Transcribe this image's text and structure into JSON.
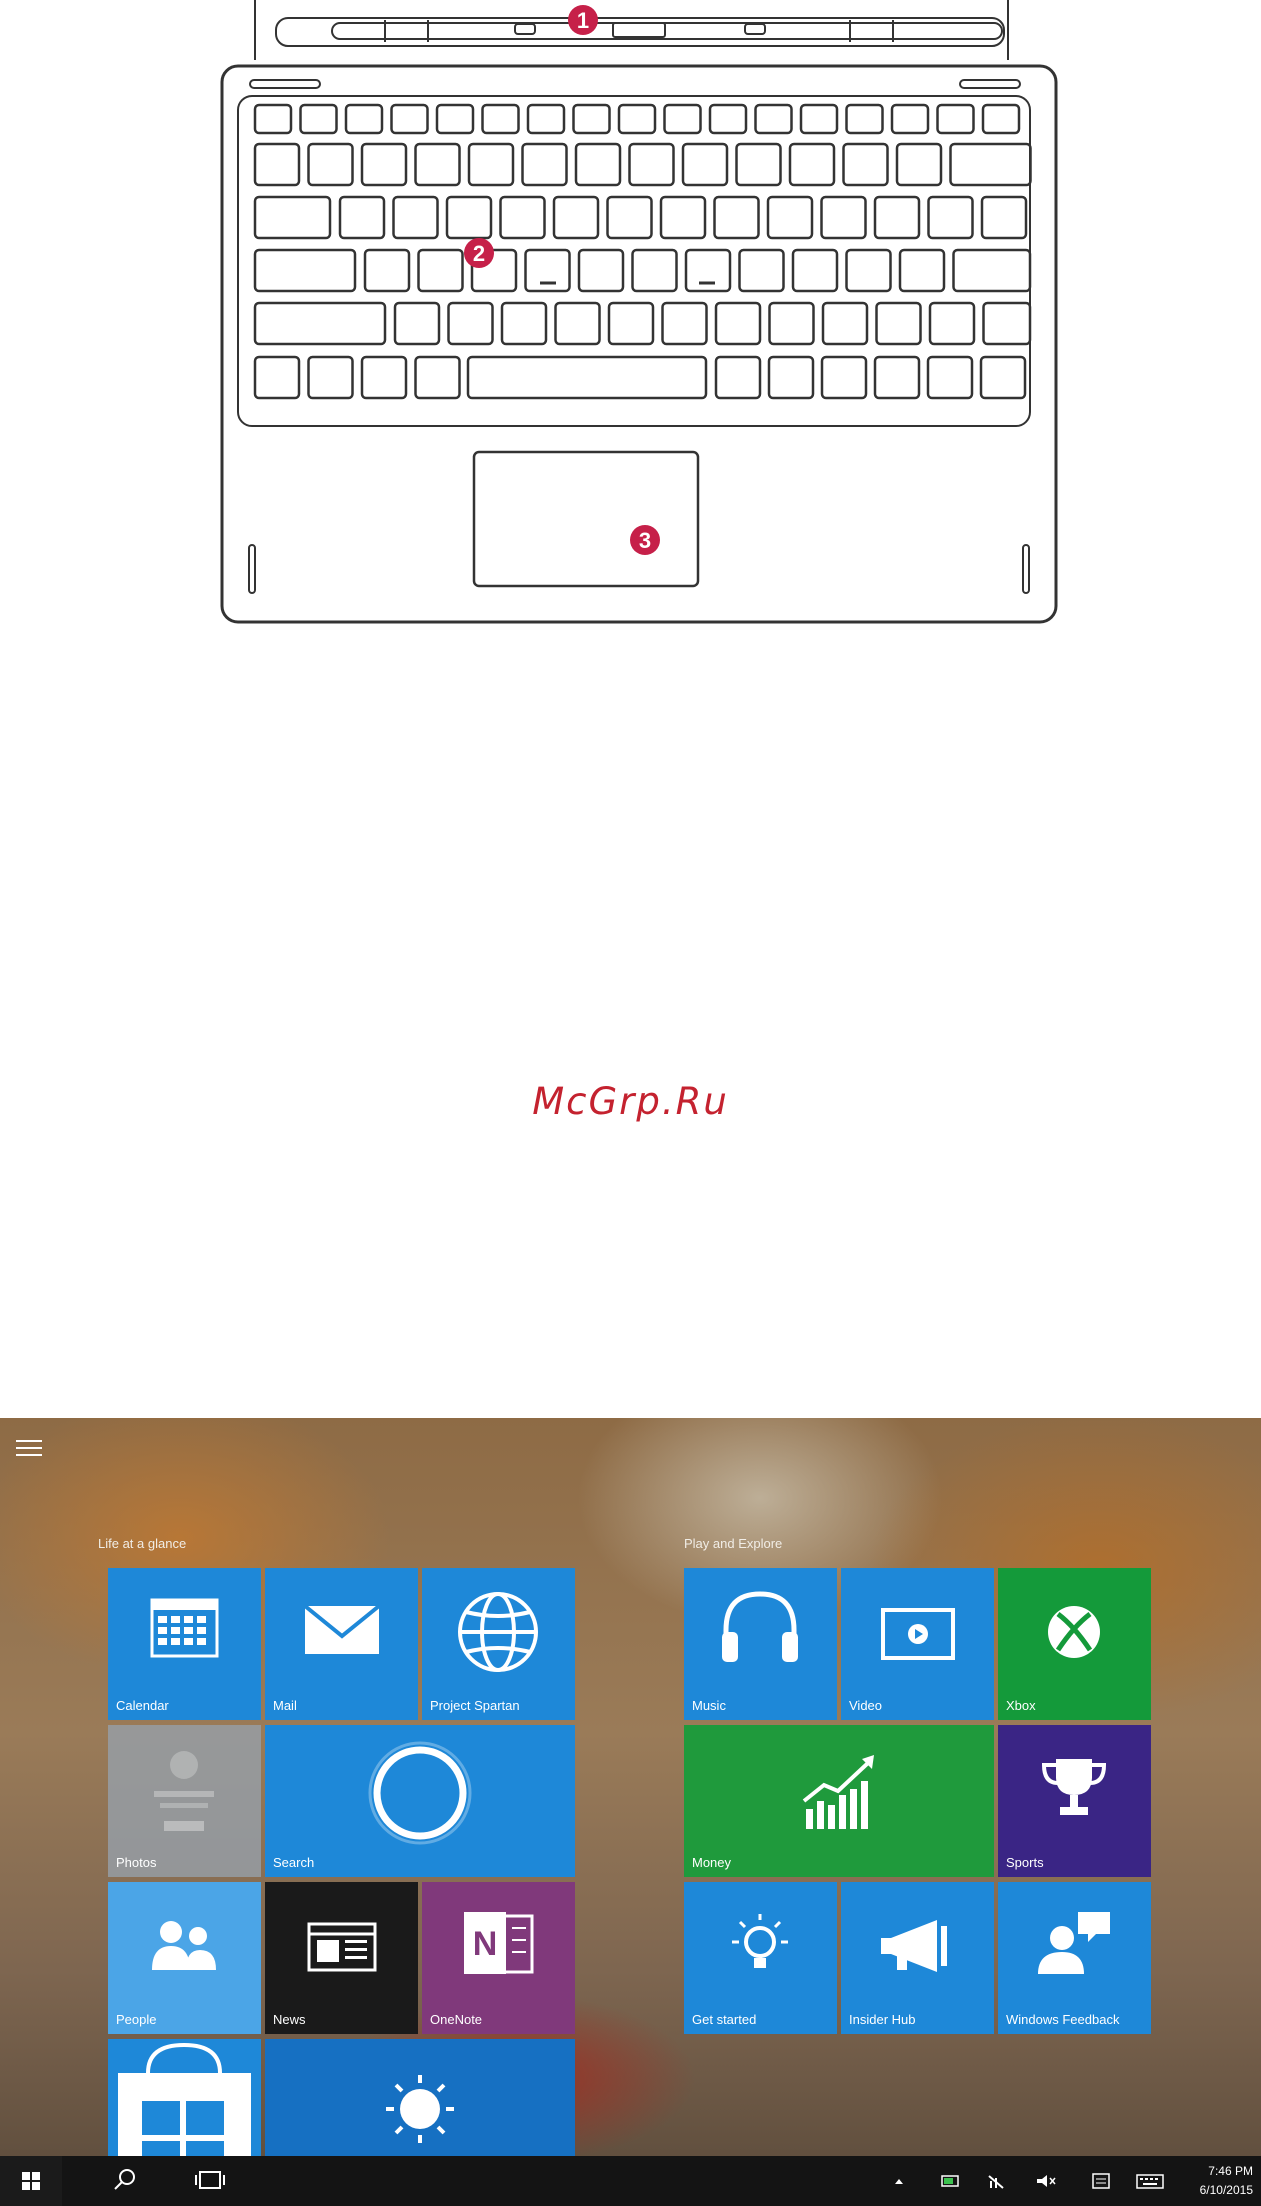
{
  "diagram": {
    "callouts": [
      "1",
      "2",
      "3"
    ]
  },
  "watermark": "McGrp.Ru",
  "start_screen": {
    "groups": [
      {
        "label": "Life at a glance"
      },
      {
        "label": "Play and Explore"
      }
    ],
    "tiles": [
      {
        "label": "Calendar",
        "icon": "calendar-icon",
        "color": "#1e88d8"
      },
      {
        "label": "Mail",
        "icon": "mail-icon",
        "color": "#1e88d8"
      },
      {
        "label": "Project Spartan",
        "icon": "globe-icon",
        "color": "#1e88d8"
      },
      {
        "label": "Photos",
        "icon": "photos-icon",
        "color": "#969fa8"
      },
      {
        "label": "Search",
        "icon": "cortana-ring-icon",
        "color": "#1e88d8"
      },
      {
        "label": "People",
        "icon": "people-icon",
        "color": "#4ba5e7"
      },
      {
        "label": "News",
        "icon": "news-icon",
        "color": "#1a1a1a"
      },
      {
        "label": "OneNote",
        "icon": "onenote-icon",
        "color": "#80397b"
      },
      {
        "label": "",
        "icon": "store-icon",
        "color": "#1e88d8"
      },
      {
        "label": "",
        "icon": "sun-icon",
        "color": "#1670c2"
      },
      {
        "label": "Music",
        "icon": "headphones-icon",
        "color": "#1e88d8"
      },
      {
        "label": "Video",
        "icon": "video-icon",
        "color": "#1e88d8"
      },
      {
        "label": "Xbox",
        "icon": "xbox-icon",
        "color": "#149a3a"
      },
      {
        "label": "Money",
        "icon": "chart-up-icon",
        "color": "#1f9a3c"
      },
      {
        "label": "Sports",
        "icon": "trophy-icon",
        "color": "#3a2585"
      },
      {
        "label": "Get started",
        "icon": "lightbulb-icon",
        "color": "#1e88d8"
      },
      {
        "label": "Insider Hub",
        "icon": "megaphone-icon",
        "color": "#1e88d8"
      },
      {
        "label": "Windows Feedback",
        "icon": "feedback-icon",
        "color": "#1e88d8"
      }
    ],
    "taskbar": {
      "time": "7:46 PM",
      "date": "6/10/2015"
    }
  }
}
